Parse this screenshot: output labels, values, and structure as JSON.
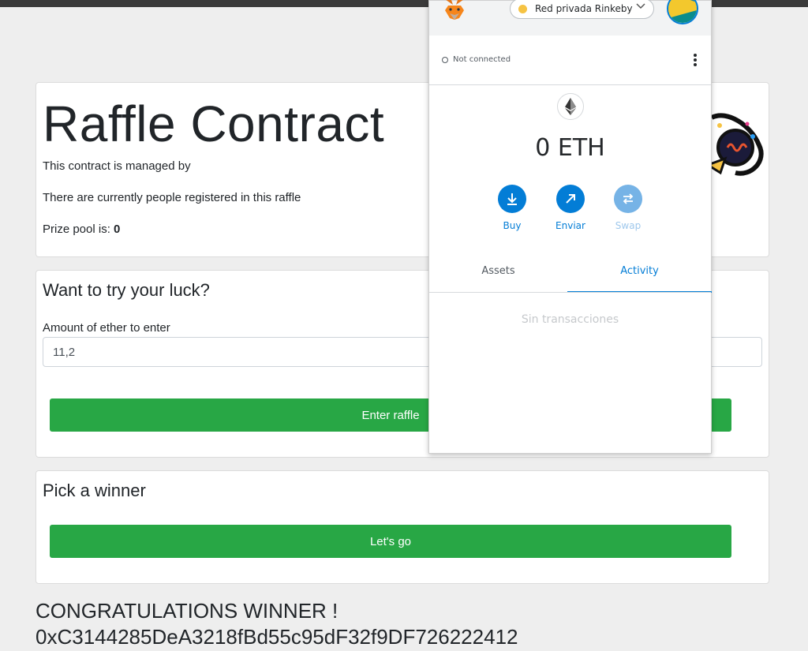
{
  "raffle": {
    "title": "Raffle Contract",
    "managed_by": "This contract is managed by",
    "registered": "There are currently people registered in this raffle",
    "prize_label": "Prize pool is: ",
    "prize_value": "0"
  },
  "luck": {
    "heading": "Want to try your luck?",
    "amount_label": "Amount of ether to enter",
    "amount_value": "11,2",
    "enter_button": "Enter raffle"
  },
  "winner": {
    "heading": "Pick a winner",
    "go_button": "Let's go"
  },
  "result": {
    "line1": "CONGRATULATIONS WINNER !",
    "line2": "0xC3144285DeA3218fBd55c95dF32f9DF726222412"
  },
  "metamask": {
    "network": "Red privada Rinkeby",
    "connection": "Not connected",
    "balance": "0 ETH",
    "actions": {
      "buy": "Buy",
      "send": "Enviar",
      "swap": "Swap"
    },
    "tabs": {
      "assets": "Assets",
      "activity": "Activity"
    },
    "empty": "Sin transacciones",
    "accent": "#037dd6"
  },
  "colors": {
    "button": "#28a745",
    "background": "#eeeeee"
  }
}
